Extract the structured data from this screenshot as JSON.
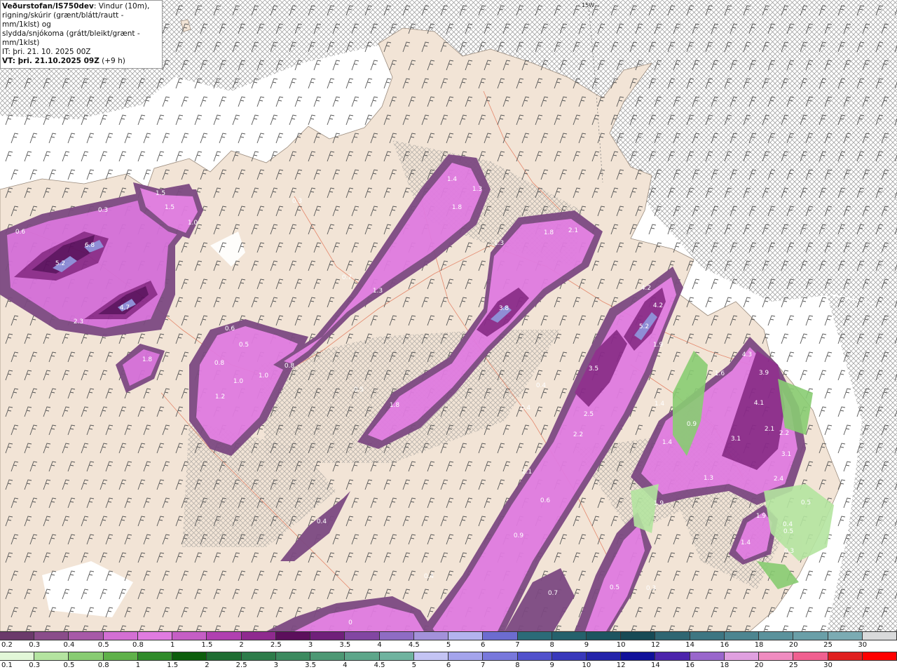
{
  "header": {
    "brand": "Veðurstofan/IS750dev",
    "desc1": ": Vindur (10m),",
    "desc2": "rigning/skúrir (grænt/blátt/rautt - mm/1klst) og",
    "desc3": "slydda/snjókoma (grátt/bleikt/grænt - mm/1klst)",
    "it": "IT: þri. 21. 10. 2025 00Z",
    "vt": "VT: þri. 21.10.2025 09Z",
    "vt_offset": " (+9 h)"
  },
  "map": {
    "gridline_label": "15W",
    "ocean_color": "#ffffff",
    "land_color": "#f2e4d6",
    "cloud_hatch_color": "#8a8a8a",
    "road_color": "#e06a4a",
    "barb_color": "#555555",
    "precip_values": [
      {
        "label": "1.5",
        "level": 2
      },
      {
        "label": "1.5",
        "level": 2
      },
      {
        "label": "0.3",
        "level": 1
      },
      {
        "label": "0.6",
        "level": 1
      },
      {
        "label": "6.8",
        "level": 4
      },
      {
        "label": "5.2",
        "level": 4
      },
      {
        "label": "1.0",
        "level": 2
      },
      {
        "label": "4.7",
        "level": 4
      },
      {
        "label": "2.3",
        "level": 3
      },
      {
        "label": "1.8",
        "level": 2
      },
      {
        "label": "0.3",
        "level": 1
      },
      {
        "label": "1.4",
        "level": 2
      },
      {
        "label": "1.3",
        "level": 2
      },
      {
        "label": "1.8",
        "level": 2
      },
      {
        "label": "1.3",
        "level": 2
      },
      {
        "label": "1.8",
        "level": 2
      },
      {
        "label": "2.1",
        "level": 3
      },
      {
        "label": "0.7",
        "level": 1
      },
      {
        "label": "1.3",
        "level": 2
      },
      {
        "label": "3.8",
        "level": 4
      },
      {
        "label": "0.6",
        "level": 1
      },
      {
        "label": "0.5",
        "level": 1
      },
      {
        "label": "0.8",
        "level": 1
      },
      {
        "label": "1.0",
        "level": 2
      },
      {
        "label": "1.0",
        "level": 2
      },
      {
        "label": "1.2",
        "level": 2
      },
      {
        "label": "0.8",
        "level": 1
      },
      {
        "label": "0.5",
        "level": 1
      },
      {
        "label": "1.8",
        "level": 2
      },
      {
        "label": "4.2",
        "level": 4
      },
      {
        "label": "4.2",
        "level": 4
      },
      {
        "label": "5.2",
        "level": 4
      },
      {
        "label": "1.9",
        "level": 2
      },
      {
        "label": "3.5",
        "level": 4
      },
      {
        "label": "0.4",
        "level": 1
      },
      {
        "label": "0.4",
        "level": 1
      },
      {
        "label": "2.5",
        "level": 3
      },
      {
        "label": "2.2",
        "level": 3
      },
      {
        "label": "1.4",
        "level": 2
      },
      {
        "label": "1.4",
        "level": 2
      },
      {
        "label": "0.9",
        "level": 1
      },
      {
        "label": "1.6",
        "level": 2
      },
      {
        "label": "4.3",
        "level": 4
      },
      {
        "label": "3.9",
        "level": 4
      },
      {
        "label": "4.1",
        "level": 4
      },
      {
        "label": "2.1",
        "level": 3
      },
      {
        "label": "2.2",
        "level": 3
      },
      {
        "label": "3.1",
        "level": 4
      },
      {
        "label": "3.1",
        "level": 4
      },
      {
        "label": "2.4",
        "level": 3
      },
      {
        "label": "1.3",
        "level": 2
      },
      {
        "label": "2.1",
        "level": 3
      },
      {
        "label": "0.6",
        "level": 1
      },
      {
        "label": "1.9",
        "level": 2
      },
      {
        "label": "0.5",
        "level": 1
      },
      {
        "label": "1.9",
        "level": 2
      },
      {
        "label": "0.4",
        "level": 1
      },
      {
        "label": "0.5",
        "level": 1
      },
      {
        "label": "1.4",
        "level": 2
      },
      {
        "label": "0.3",
        "level": 1
      },
      {
        "label": "0.9",
        "level": 1
      },
      {
        "label": "0.4",
        "level": 1
      },
      {
        "label": "0.4",
        "level": 1
      },
      {
        "label": "0.7",
        "level": 1
      },
      {
        "label": "0.5",
        "level": 1
      },
      {
        "label": "0.3",
        "level": 1
      },
      {
        "label": "0",
        "level": 1
      }
    ]
  },
  "scale_snow": {
    "labels": [
      "0.2",
      "0.3",
      "0.4",
      "0.5",
      "0.8",
      "1",
      "1.5",
      "2",
      "2.5",
      "3",
      "3.5",
      "4",
      "4.5",
      "5",
      "6",
      "7",
      "8",
      "9",
      "10",
      "12",
      "14",
      "16",
      "18",
      "20",
      "25",
      "30"
    ],
    "colors": [
      "#6b3a6b",
      "#8a4d8a",
      "#a75aa7",
      "#d36fd3",
      "#e07be0",
      "#c55ec5",
      "#b040b0",
      "#8f2a8f",
      "#5c0f5c",
      "#70207a",
      "#8246a2",
      "#8f6cc4",
      "#a391da",
      "#b3b3ee",
      "#6c6cd0",
      "#2b6b78",
      "#25616c",
      "#1d5560",
      "#174a55",
      "#2f6672",
      "#3e7682",
      "#4d8590",
      "#5b929c",
      "#6a9fa8",
      "#7babb3",
      "#d9dadb"
    ]
  },
  "scale_rain": {
    "labels": [
      "0.1",
      "0.3",
      "0.5",
      "0.8",
      "1",
      "1.5",
      "2",
      "2.5",
      "3",
      "3.5",
      "4",
      "4.5",
      "5",
      "6",
      "7",
      "8",
      "9",
      "10",
      "12",
      "14",
      "16",
      "18",
      "20",
      "25",
      "30"
    ],
    "colors": [
      "#e2f7d8",
      "#b4e4a0",
      "#88cc72",
      "#5fb14a",
      "#2f8b2a",
      "#0c5e0c",
      "#1e6d32",
      "#2d7c4a",
      "#3c8a5f",
      "#4d9874",
      "#5da68a",
      "#6fb39f",
      "#c4c4f4",
      "#a4a4ec",
      "#7878dc",
      "#5151cc",
      "#3838bb",
      "#2323aa",
      "#10109a",
      "#4c24ac",
      "#9966cc",
      "#e0a0e0",
      "#f08cc0",
      "#f06090",
      "#e02020",
      "#ff0000"
    ]
  }
}
